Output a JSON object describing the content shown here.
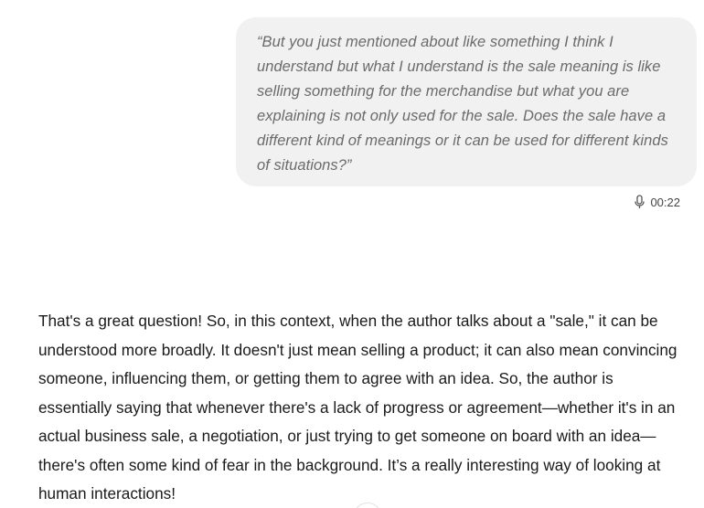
{
  "user_message": {
    "text": "“But you just mentioned about like something I think I understand but what I understand is the sale meaning is like selling something for the merchandise but what you are explaining is not only used for the sale. Does the sale have a different kind of meanings or it can be used for different kinds of situations?”",
    "duration": "00:22",
    "icon": "microphone-icon"
  },
  "assistant_message": {
    "text": "That's a great question! So, in this context, when the author talks about a \"sale,\" it can be understood more broadly. It doesn't just mean selling a product; it can also mean convincing someone, influencing them, or getting them to agree with an idea. So, the author is essentially saying that whenever there's a lack of progress or agreement—whether it's in an actual business sale, a negotiation, or just trying to get someone on board with an idea—there's often some kind of fear in the background. It’s a really interesting way of looking at human interactions!"
  }
}
